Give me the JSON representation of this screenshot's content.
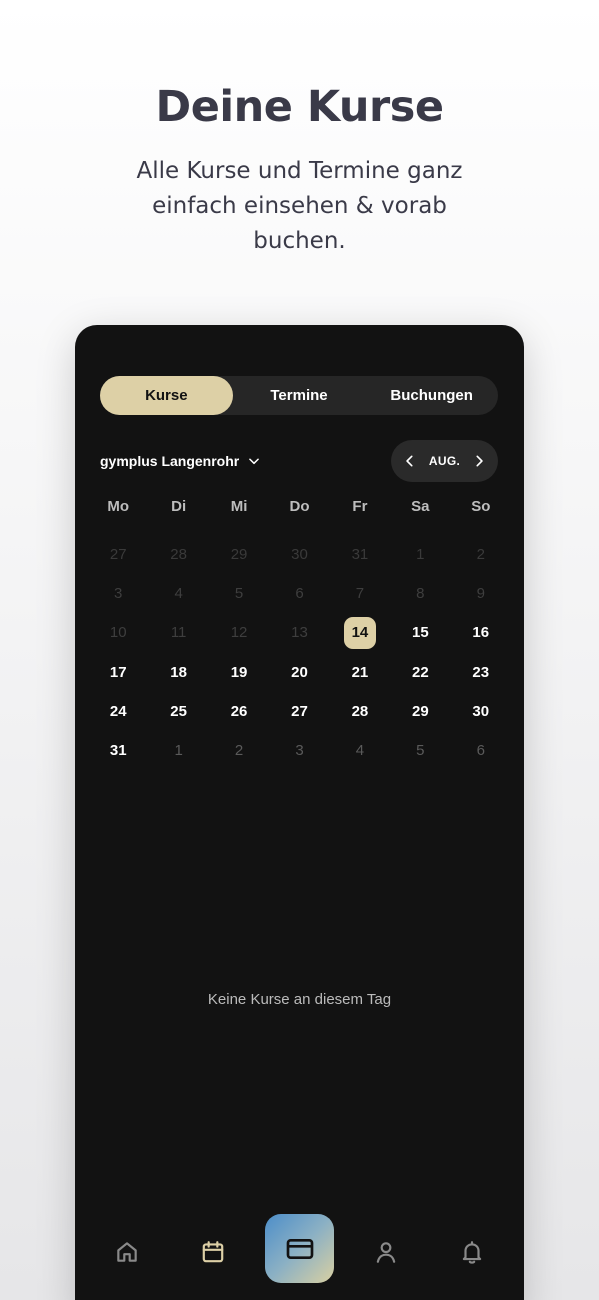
{
  "headline": "Deine Kurse",
  "subline": "Alle Kurse und Termine ganz einfach einsehen & vorab buchen.",
  "tabs": [
    {
      "label": "Kurse",
      "active": true
    },
    {
      "label": "Termine",
      "active": false
    },
    {
      "label": "Buchungen",
      "active": false
    }
  ],
  "location": {
    "name": "gymplus Langenrohr",
    "icon": "chevron-down-icon"
  },
  "month_nav": {
    "label": "AUG.",
    "prev_icon": "chevron-left-icon",
    "next_icon": "chevron-right-icon"
  },
  "weekdays": [
    "Mo",
    "Di",
    "Mi",
    "Do",
    "Fr",
    "Sa",
    "So"
  ],
  "weeks": [
    [
      "27",
      "28",
      "29",
      "30",
      "31",
      "1",
      "2"
    ],
    [
      "3",
      "4",
      "5",
      "6",
      "7",
      "8",
      "9"
    ],
    [
      "10",
      "11",
      "12",
      "13",
      "14",
      "15",
      "16"
    ],
    [
      "17",
      "18",
      "19",
      "20",
      "21",
      "22",
      "23"
    ],
    [
      "24",
      "25",
      "26",
      "27",
      "28",
      "29",
      "30"
    ],
    [
      "31",
      "1",
      "2",
      "3",
      "4",
      "5",
      "6"
    ]
  ],
  "selected_day": "14",
  "empty_message": "Keine Kurse an diesem Tag",
  "nav": {
    "items": [
      "home-icon",
      "calendar-icon",
      "card-icon",
      "profile-icon",
      "bell-icon"
    ],
    "active": "calendar-icon"
  },
  "colors": {
    "accent": "#ddd0a6",
    "background": "#121212",
    "surface": "#262626"
  }
}
